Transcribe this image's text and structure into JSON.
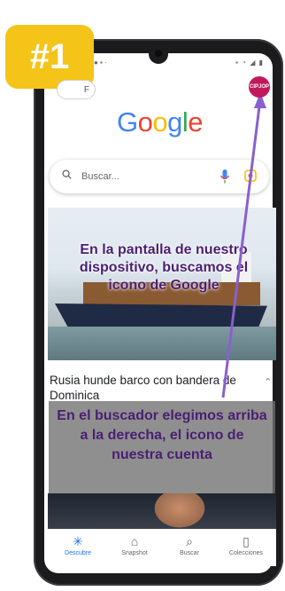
{
  "badge": {
    "label": "#1"
  },
  "status": {
    "left": "● ▪ ·",
    "right": "▪ ◔ ◢ ▮"
  },
  "top_chip": {
    "label": "F"
  },
  "account": {
    "avatar_text": "CIPJOP"
  },
  "google_logo": [
    "G",
    "o",
    "o",
    "g",
    "l",
    "e"
  ],
  "search": {
    "placeholder": "Buscar..."
  },
  "news": {
    "overlay_caption": "En la pantalla de nuestro dispositivo, buscamos el icono de Google",
    "headline_line1": "Rusia hunde barco con bandera de",
    "headline_line2": "Dominica"
  },
  "callout": {
    "text": "En el buscador elegimos arriba a la derecha, el icono de nuestra cuenta"
  },
  "nav": [
    {
      "label": "Descubre",
      "icon": "asterisk-icon",
      "glyph": "✳",
      "active": true
    },
    {
      "label": "Snapshot",
      "icon": "snapshot-icon",
      "glyph": "⌂",
      "active": false
    },
    {
      "label": "Buscar",
      "icon": "search-icon",
      "glyph": "⌕",
      "active": false
    },
    {
      "label": "Colecciones",
      "icon": "collections-icon",
      "glyph": "▯",
      "active": false
    }
  ],
  "colors": {
    "badge": "#f4c418",
    "caption": "#4a1f72",
    "arrow": "#8a5fcf",
    "avatar": "#c2185b",
    "active_nav": "#1a73e8"
  }
}
